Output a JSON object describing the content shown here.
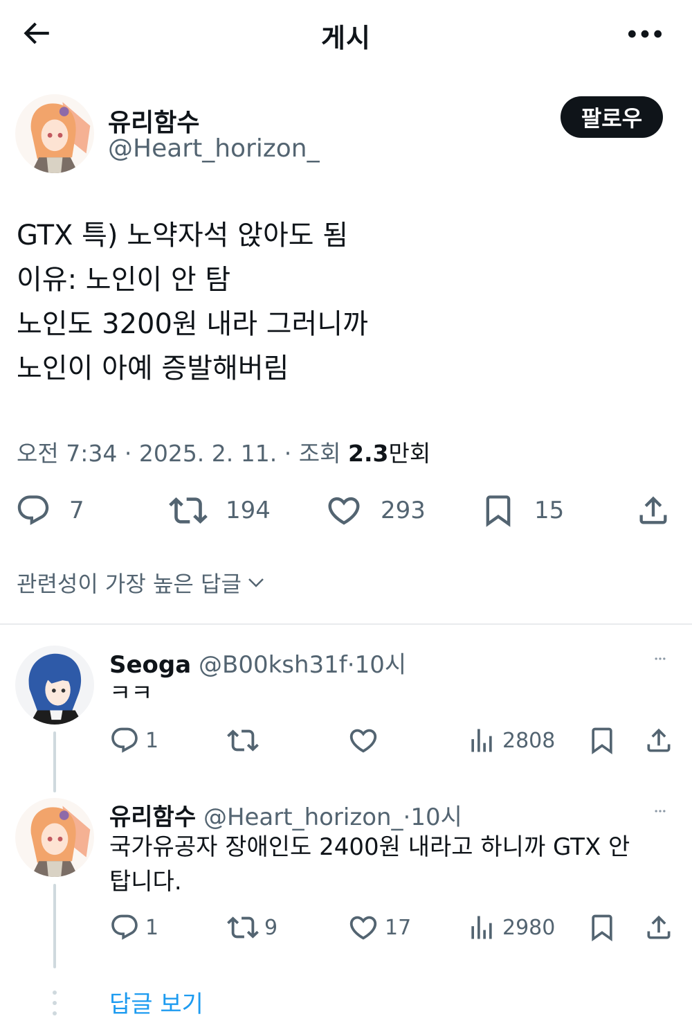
{
  "header": {
    "title": "게시",
    "back_icon": "arrow-left-icon",
    "more_icon": "more-horizontal-icon"
  },
  "post": {
    "author": {
      "name": "유리함수",
      "handle": "@Heart_horizon_",
      "avatar": "anime-girl-orange-hair-avatar"
    },
    "follow_label": "팔로우",
    "lines": [
      "GTX 특) 노약자석 앉아도 됨",
      "이유: 노인이 안 탐",
      "노인도 3200원 내라 그러니까",
      "노인이 아예 증발해버림"
    ],
    "meta": {
      "time": "오전 7:34",
      "sep": "·",
      "date": "2025. 2. 11.",
      "views_label": "조회",
      "views_num": "2.3",
      "views_unit": "만회"
    },
    "stats": {
      "replies": "7",
      "reposts": "194",
      "likes": "293",
      "bookmarks": "15"
    }
  },
  "sort_label": "관련성이 가장 높은 답글",
  "replies": [
    {
      "name": "Seoga",
      "handle": "@B00ksh31f",
      "sep": "·",
      "time": "10시",
      "avatar": "anime-girl-blue-hair-avatar",
      "text": "ㅋㅋ",
      "stats": {
        "replies": "1",
        "reposts": "",
        "likes": "",
        "views": "2808"
      }
    },
    {
      "name": "유리함수",
      "handle": "@Heart_horizon_",
      "sep": "·",
      "time": "10시",
      "avatar": "anime-girl-orange-hair-avatar",
      "text_lines": [
        "국가유공자 장애인도 2400원 내라고 하니까 GTX 안",
        "탑니다."
      ],
      "stats": {
        "replies": "1",
        "reposts": "9",
        "likes": "17",
        "views": "2980"
      }
    }
  ],
  "show_replies_label": "답글 보기",
  "colors": {
    "text": "#0f1419",
    "muted": "#536471",
    "link": "#1d9bf0",
    "follow_bg": "#0f1419"
  }
}
